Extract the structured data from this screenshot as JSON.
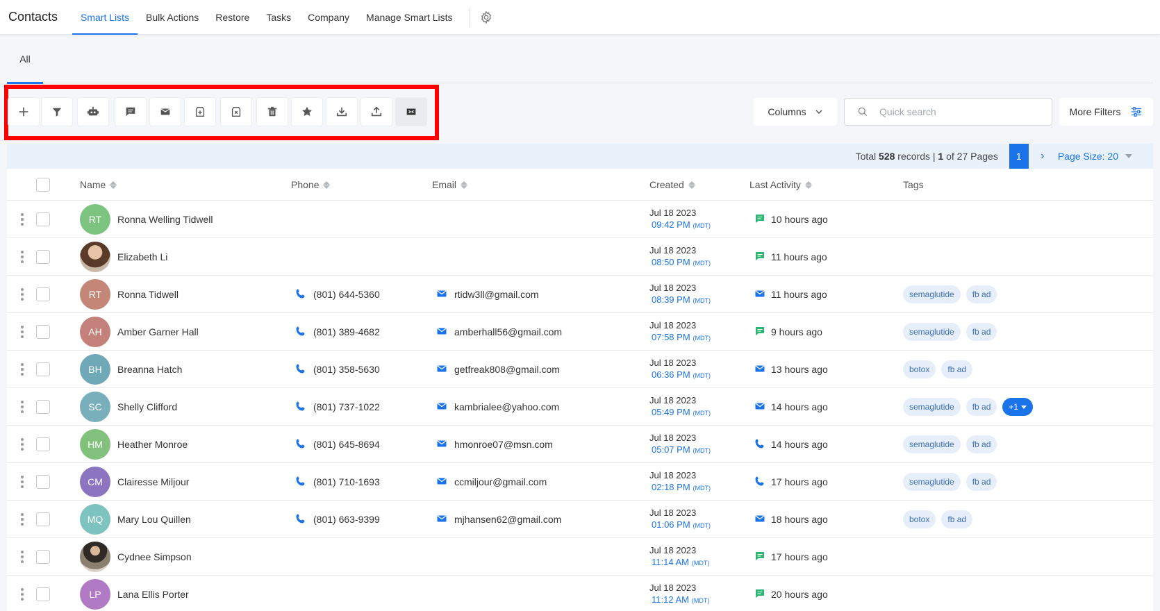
{
  "header": {
    "title": "Contacts",
    "nav": [
      {
        "label": "Smart Lists",
        "active": true
      },
      {
        "label": "Bulk Actions",
        "active": false
      },
      {
        "label": "Restore",
        "active": false
      },
      {
        "label": "Tasks",
        "active": false
      },
      {
        "label": "Company",
        "active": false
      },
      {
        "label": "Manage Smart Lists",
        "active": false
      }
    ]
  },
  "subtabs": {
    "all": "All"
  },
  "toolbar": {
    "buttons": [
      "add-icon",
      "filter-icon",
      "robot-icon",
      "message-icon",
      "email-icon",
      "add-tag-icon",
      "remove-tag-icon",
      "delete-icon",
      "star-icon",
      "import-icon",
      "export-icon",
      "merge-icon"
    ],
    "columns_label": "Columns",
    "search_placeholder": "Quick search",
    "more_filters_label": "More Filters"
  },
  "pagination": {
    "total_prefix": "Total",
    "total": "528",
    "records_text": "records |",
    "page": "1",
    "of_pages": "of 27 Pages",
    "current_page": "1",
    "page_size_label": "Page Size: 20"
  },
  "table": {
    "headers": {
      "name": "Name",
      "phone": "Phone",
      "email": "Email",
      "created": "Created",
      "last_activity": "Last Activity",
      "tags": "Tags"
    },
    "rows": [
      {
        "initials": "RT",
        "avatar_color": "#7cc47f",
        "name": "Ronna Welling Tidwell",
        "phone": "",
        "email": "",
        "date": "Jul 18 2023",
        "time": "09:42 PM",
        "tz": "(MDT)",
        "activity_icon": "sms-icon",
        "activity": "10 hours ago",
        "tags": []
      },
      {
        "initials": "",
        "avatar_color": "photo",
        "name": "Elizabeth Li",
        "phone": "",
        "email": "",
        "date": "Jul 18 2023",
        "time": "08:50 PM",
        "tz": "(MDT)",
        "activity_icon": "sms-icon",
        "activity": "11 hours ago",
        "tags": []
      },
      {
        "initials": "RT",
        "avatar_color": "#c48676",
        "name": "Ronna Tidwell",
        "phone": "(801) 644-5360",
        "email": "rtidw3ll@gmail.com",
        "date": "Jul 18 2023",
        "time": "08:39 PM",
        "tz": "(MDT)",
        "activity_icon": "email-icon",
        "activity": "11 hours ago",
        "tags": [
          "semaglutide",
          "fb ad"
        ]
      },
      {
        "initials": "AH",
        "avatar_color": "#c4807a",
        "name": "Amber Garner Hall",
        "phone": "(801) 389-4682",
        "email": "amberhall56@gmail.com",
        "date": "Jul 18 2023",
        "time": "07:58 PM",
        "tz": "(MDT)",
        "activity_icon": "sms-icon",
        "activity": "9 hours ago",
        "tags": [
          "semaglutide",
          "fb ad"
        ]
      },
      {
        "initials": "BH",
        "avatar_color": "#6fa8b6",
        "name": "Breanna Hatch",
        "phone": "(801) 358-5630",
        "email": "getfreak808@gmail.com",
        "date": "Jul 18 2023",
        "time": "06:36 PM",
        "tz": "(MDT)",
        "activity_icon": "email-icon",
        "activity": "13 hours ago",
        "tags": [
          "botox",
          "fb ad"
        ]
      },
      {
        "initials": "SC",
        "avatar_color": "#79afbb",
        "name": "Shelly Clifford",
        "phone": "(801) 737-1022",
        "email": "kambrialee@yahoo.com",
        "date": "Jul 18 2023",
        "time": "05:49 PM",
        "tz": "(MDT)",
        "activity_icon": "email-icon",
        "activity": "14 hours ago",
        "tags": [
          "semaglutide",
          "fb ad"
        ],
        "more_tags": "+1"
      },
      {
        "initials": "HM",
        "avatar_color": "#82c07e",
        "name": "Heather Monroe",
        "phone": "(801) 645-8694",
        "email": "hmonroe07@msn.com",
        "date": "Jul 18 2023",
        "time": "05:07 PM",
        "tz": "(MDT)",
        "activity_icon": "phone-icon",
        "activity": "14 hours ago",
        "tags": [
          "semaglutide",
          "fb ad"
        ]
      },
      {
        "initials": "CM",
        "avatar_color": "#8c74c0",
        "name": "Clairesse Miljour",
        "phone": "(801) 710-1693",
        "email": "ccmiljour@gmail.com",
        "date": "Jul 18 2023",
        "time": "02:18 PM",
        "tz": "(MDT)",
        "activity_icon": "phone-icon",
        "activity": "17 hours ago",
        "tags": [
          "semaglutide",
          "fb ad"
        ]
      },
      {
        "initials": "MQ",
        "avatar_color": "#7dc4c0",
        "name": "Mary Lou Quillen",
        "phone": "(801) 663-9399",
        "email": "mjhansen62@gmail.com",
        "date": "Jul 18 2023",
        "time": "01:06 PM",
        "tz": "(MDT)",
        "activity_icon": "email-icon",
        "activity": "18 hours ago",
        "tags": [
          "botox",
          "fb ad"
        ]
      },
      {
        "initials": "",
        "avatar_color": "photo2",
        "name": "Cydnee Simpson",
        "phone": "",
        "email": "",
        "date": "Jul 18 2023",
        "time": "11:14 AM",
        "tz": "(MDT)",
        "activity_icon": "sms-icon",
        "activity": "17 hours ago",
        "tags": []
      },
      {
        "initials": "LP",
        "avatar_color": "#b07ac4",
        "name": "Lana Ellis Porter",
        "phone": "",
        "email": "",
        "date": "Jul 18 2023",
        "time": "11:12 AM",
        "tz": "(MDT)",
        "activity_icon": "sms-icon",
        "activity": "20 hours ago",
        "tags": []
      }
    ]
  },
  "colors": {
    "accent": "#1a73e8",
    "sms": "#2bb673",
    "highlight": "#ff0000"
  }
}
